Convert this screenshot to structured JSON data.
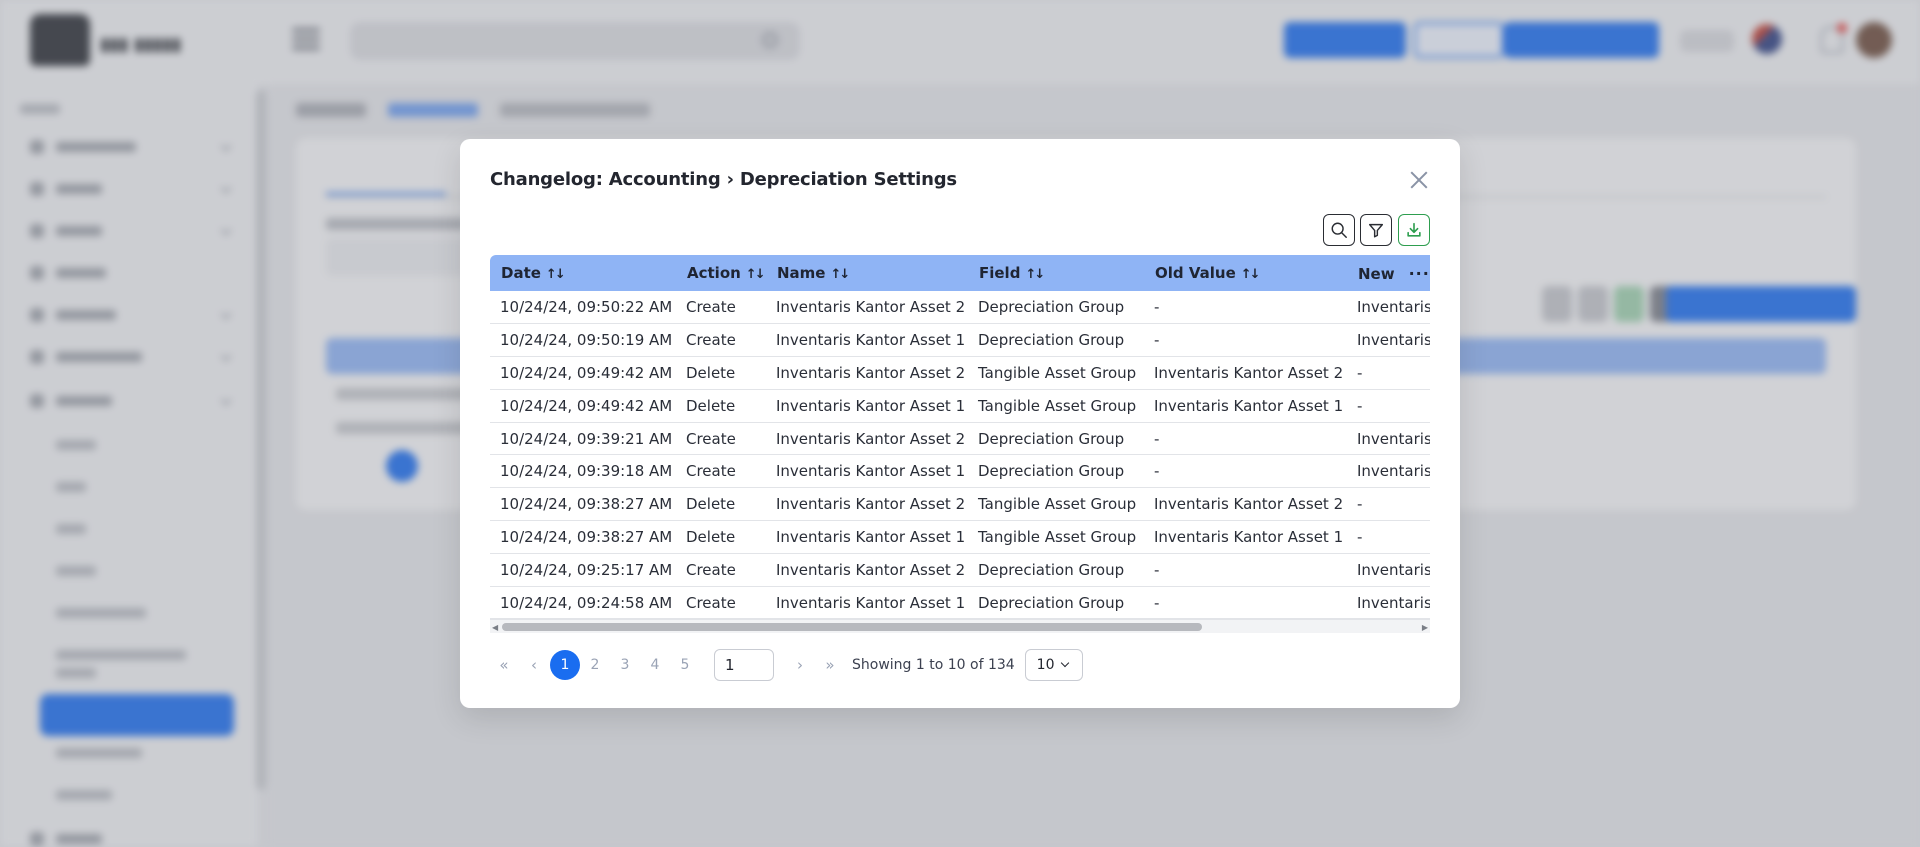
{
  "modal": {
    "title": "Changelog: Accounting › Depreciation Settings",
    "columns": [
      "Date",
      "Action",
      "Name",
      "Field",
      "Old Value",
      "New"
    ],
    "rows": [
      [
        "10/24/24, 09:50:22 AM",
        "Create",
        "Inventaris Kantor Asset 2",
        "Depreciation Group",
        "-",
        "Inventaris"
      ],
      [
        "10/24/24, 09:50:19 AM",
        "Create",
        "Inventaris Kantor Asset 1",
        "Depreciation Group",
        "-",
        "Inventaris"
      ],
      [
        "10/24/24, 09:49:42 AM",
        "Delete",
        "Inventaris Kantor Asset 2",
        "Tangible Asset Group",
        "Inventaris Kantor Asset 2",
        "-"
      ],
      [
        "10/24/24, 09:49:42 AM",
        "Delete",
        "Inventaris Kantor Asset 1",
        "Tangible Asset Group",
        "Inventaris Kantor Asset 1",
        "-"
      ],
      [
        "10/24/24, 09:39:21 AM",
        "Create",
        "Inventaris Kantor Asset 2",
        "Depreciation Group",
        "-",
        "Inventaris"
      ],
      [
        "10/24/24, 09:39:18 AM",
        "Create",
        "Inventaris Kantor Asset 1",
        "Depreciation Group",
        "-",
        "Inventaris"
      ],
      [
        "10/24/24, 09:38:27 AM",
        "Delete",
        "Inventaris Kantor Asset 2",
        "Tangible Asset Group",
        "Inventaris Kantor Asset 2",
        "-"
      ],
      [
        "10/24/24, 09:38:27 AM",
        "Delete",
        "Inventaris Kantor Asset 1",
        "Tangible Asset Group",
        "Inventaris Kantor Asset 1",
        "-"
      ],
      [
        "10/24/24, 09:25:17 AM",
        "Create",
        "Inventaris Kantor Asset 2",
        "Depreciation Group",
        "-",
        "Inventaris"
      ],
      [
        "10/24/24, 09:24:58 AM",
        "Create",
        "Inventaris Kantor Asset 1",
        "Depreciation Group",
        "-",
        "Inventaris"
      ]
    ],
    "pagination": {
      "pages": [
        "1",
        "2",
        "3",
        "4",
        "5"
      ],
      "active_page": "1",
      "page_input": "1",
      "showing": "Showing 1 to 10 of 134",
      "page_size": "10"
    },
    "icons": {
      "search": "search-icon",
      "filter": "filter-icon",
      "download": "download-icon",
      "close": "close-icon",
      "more": "more-horizontal-icon"
    },
    "sort_glyph": "↑↓",
    "more_glyph": "···"
  },
  "colors": {
    "accent": "#1a6df0",
    "header_bg": "#8fb4f5",
    "download_green": "#2e9e4f"
  }
}
